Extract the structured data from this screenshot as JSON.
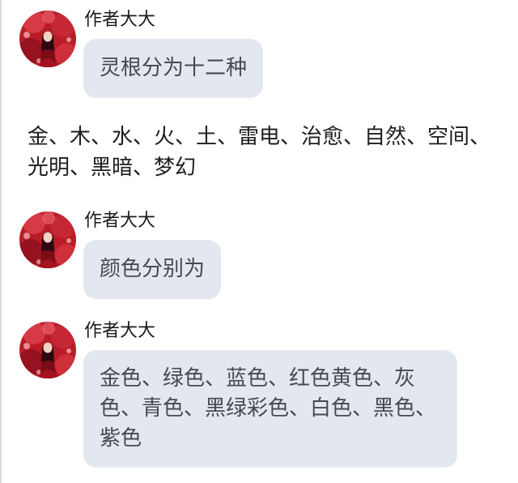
{
  "messages": [
    {
      "author": "作者大大",
      "text": "灵根分为十二种"
    },
    {
      "author": "作者大大",
      "text": "颜色分别为"
    },
    {
      "author": "作者大大",
      "text": "金色、绿色、蓝色、红色黄色、灰色、青色、黑绿彩色、白色、黑色、紫色"
    }
  ],
  "plain_text": "金、木、水、火、土、雷电、治愈、自然、空间、光明、黑暗、梦幻",
  "colors": {
    "bubble_bg": "#e3e8f0",
    "bubble_text": "#454a52",
    "author_text": "#1b1b1b",
    "plain_text": "#1d1d1d"
  }
}
